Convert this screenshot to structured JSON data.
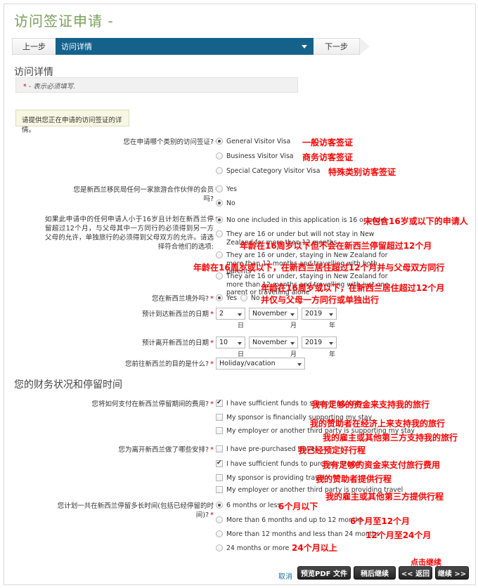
{
  "header": {
    "title": "访问签证申请 -"
  },
  "nav": {
    "prev_label": "上一步",
    "current_step": "访问详情",
    "next_label": "下一步"
  },
  "section1": {
    "title": "访问详情",
    "required_note": "- 表示必须填写.",
    "info_box": "请提供您正在申请的访问签证的详情。",
    "q1": {
      "label": "您在申请哪个类别的访问签证?",
      "options": [
        {
          "text": "General Visitor Visa",
          "selected": true,
          "anno": "一般访客签证"
        },
        {
          "text": "Business Visitor Visa",
          "selected": false,
          "anno": "商务访客签证"
        },
        {
          "text": "Special Category Visitor Visa",
          "selected": false,
          "anno": "特殊类别访客签证"
        }
      ]
    },
    "q2": {
      "label": "您是新西兰移民局任何一家旅游合作伙伴的会员吗?",
      "options": [
        {
          "text": "Yes",
          "selected": false
        },
        {
          "text": "No",
          "selected": true
        }
      ]
    },
    "q3": {
      "label": "如果此申请中的任何申请人小于16岁且计划在新西兰停留超过12个月，与父母其中一方同行的必须得到另一方父母的允许，单独旅行的必须得到父母双方的允许。请选择符合他们的选项:",
      "options": [
        {
          "text": "No one included in this application is 16 or under",
          "selected": true,
          "anno": "未包含16岁或以下的申请人"
        },
        {
          "text": "They are 16 or under but will not stay in New Zealand for more than 12 months",
          "selected": false,
          "anno": "年龄在16周岁以下但不会在新西兰停留超过12个月"
        },
        {
          "text": "They are 16 or under, staying in New Zealand for more than 12 months and travelling with both parents",
          "selected": false,
          "anno": "年龄在16周岁或以下，在新西兰居住超过12个月并与父母双方同行"
        },
        {
          "text": "They are 16 or under, staying in New Zealand for more than 12 months and travelling with just one parent or travelling alone",
          "selected": false,
          "anno1": "年龄在16周岁或以下，在新西兰居住超过12个月",
          "anno2": "并仅与父母一方同行或单独出行"
        }
      ]
    },
    "q4": {
      "label": "您在新西兰境外吗?",
      "options": [
        {
          "text": "Yes",
          "selected": true
        },
        {
          "text": "No",
          "selected": false
        }
      ]
    },
    "q5": {
      "label": "预计到达新西兰的日期",
      "day": "2",
      "month": "November",
      "year": "2019",
      "day_unit": "日",
      "month_unit": "月",
      "year_unit": "年"
    },
    "q6": {
      "label": "预计离开新西兰的日期",
      "day": "10",
      "month": "November",
      "year": "2019",
      "day_unit": "日",
      "month_unit": "月",
      "year_unit": "年"
    },
    "q7": {
      "label": "您前往新西兰的目的是什么?",
      "value": "Holiday/vacation"
    }
  },
  "section2": {
    "title": "您的财务状况和停留时间",
    "q1": {
      "label": "您将如何支付在新西兰停留期间的费用?",
      "options": [
        {
          "text": "I have sufficient funds to support my stay",
          "checked": true,
          "anno": "我有足够的资金来支持我的旅行"
        },
        {
          "text": "My sponsor is financially supporting my stay",
          "checked": false,
          "anno": "我的赞助者在经济上来支持我的旅行"
        },
        {
          "text": "My employer or another third party is supporting my stay",
          "checked": false,
          "anno": "我的雇主或其他第三方支持我的旅行"
        }
      ]
    },
    "q2": {
      "label": "您为离开新西兰做了哪些安排?",
      "options": [
        {
          "text": "I have pre-purchased travel",
          "checked": false,
          "anno": "我已经预定好行程"
        },
        {
          "text": "I have sufficient funds to purchase travel",
          "checked": true,
          "anno": "我有足够的资金来支付旅行费用"
        },
        {
          "text": "My sponsor is providing travel",
          "checked": false,
          "anno": "我的赞助者提供行程"
        },
        {
          "text": "My employer or another third party is providing travel",
          "checked": false,
          "anno": "我的雇主或其他第三方提供行程"
        }
      ]
    },
    "q3": {
      "label": "您计划一共在新西兰停留多长时间(包括已经停留的时间)?",
      "options": [
        {
          "text": "6 months or less",
          "selected": true,
          "anno": "6个月以下"
        },
        {
          "text": "More than 6 months and up to 12 months",
          "selected": false,
          "anno": "6个月至12个月"
        },
        {
          "text": "More than 12 months and less than 24 months",
          "selected": false,
          "anno": "12个月至24个月"
        },
        {
          "text": "24 months or more",
          "selected": false,
          "anno": "24个月以上"
        }
      ]
    }
  },
  "footer": {
    "continue_anno": "点击继续",
    "cancel": "取消",
    "preview_pdf": "预览PDF 文件",
    "continue_later": "稍后继续",
    "back": "<< 返回",
    "next": "继续 >>"
  },
  "colors": {
    "title_green": "#7ba05b",
    "nav_blue": "#14628c",
    "annotation_red": "#ff0000",
    "required_star": "#cc0000"
  }
}
